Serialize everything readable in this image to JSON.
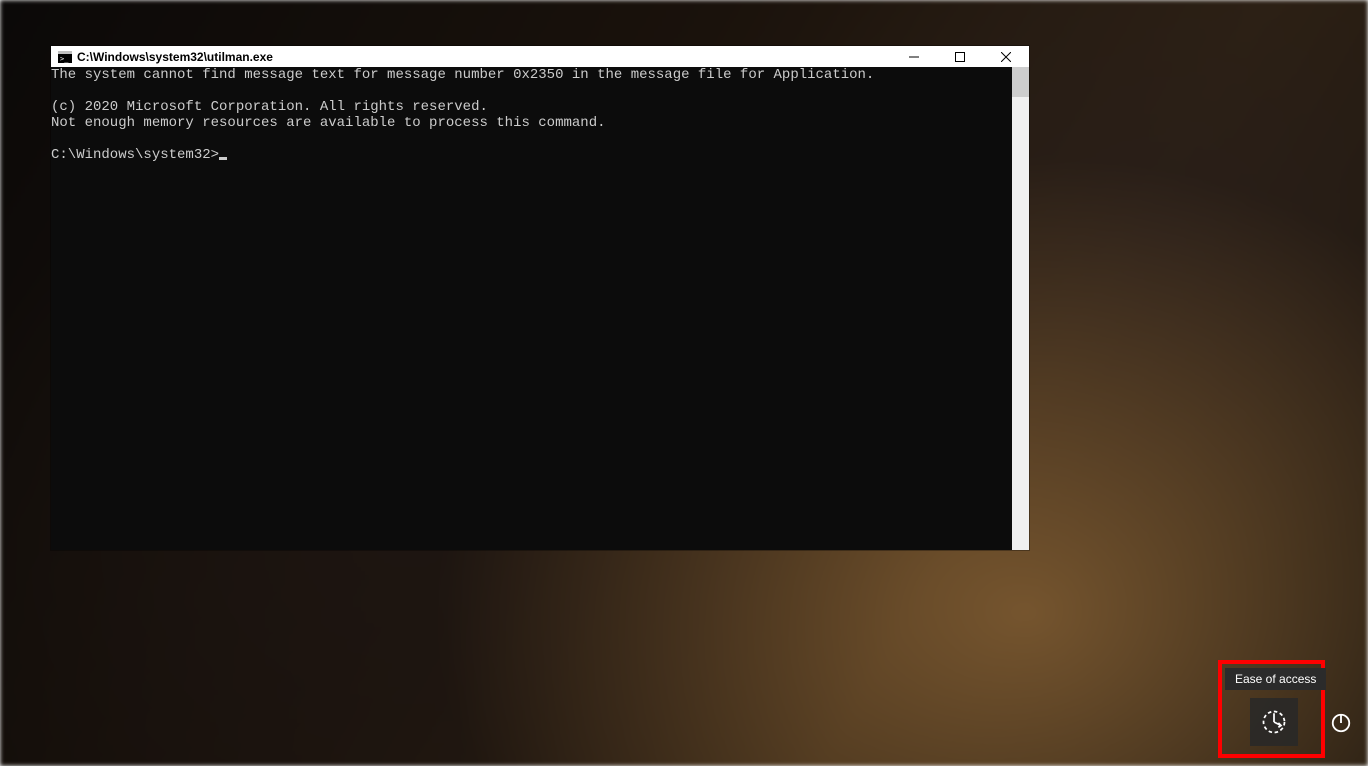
{
  "window": {
    "title": "C:\\Windows\\system32\\utilman.exe"
  },
  "terminal": {
    "lines": [
      "The system cannot find message text for message number 0x2350 in the message file for Application.",
      "",
      "(c) 2020 Microsoft Corporation. All rights reserved.",
      "Not enough memory resources are available to process this command.",
      ""
    ],
    "prompt": "C:\\Windows\\system32>"
  },
  "tooltip": {
    "ease_of_access": "Ease of access"
  },
  "icons": {
    "terminal": "cmd-icon",
    "minimize": "minimize-icon",
    "maximize": "maximize-icon",
    "close": "close-icon",
    "ease": "ease-of-access-icon",
    "power": "power-icon"
  }
}
